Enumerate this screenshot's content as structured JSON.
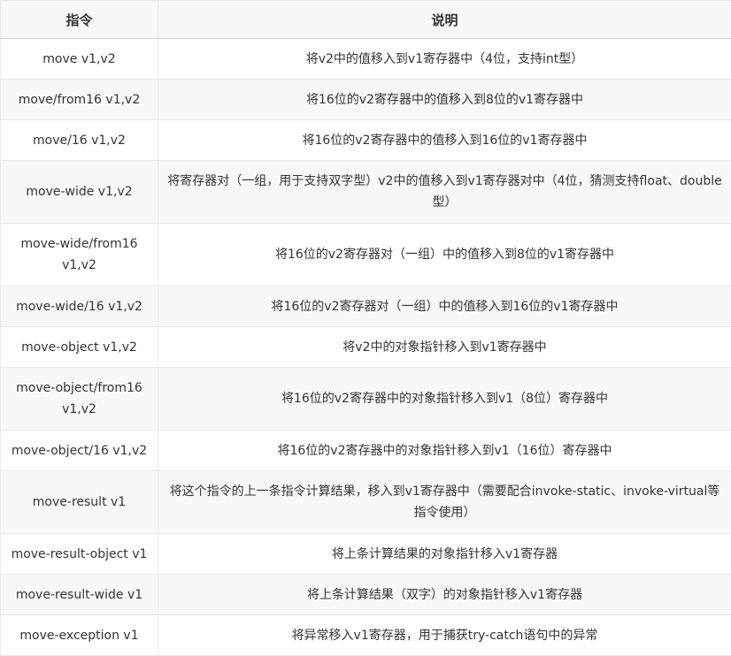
{
  "table": {
    "headers": [
      "指令",
      "说明"
    ],
    "rows": [
      {
        "instr": "move v1,v2",
        "desc": "将v2中的值移入到v1寄存器中（4位，支持int型）"
      },
      {
        "instr": "move/from16 v1,v2",
        "desc": "将16位的v2寄存器中的值移入到8位的v1寄存器中"
      },
      {
        "instr": "move/16 v1,v2",
        "desc": "将16位的v2寄存器中的值移入到16位的v1寄存器中"
      },
      {
        "instr": "move-wide v1,v2",
        "desc": "将寄存器对（一组，用于支持双字型）v2中的值移入到v1寄存器对中（4位，猜测支持float、double型）"
      },
      {
        "instr": "move-wide/from16 v1,v2",
        "desc": "将16位的v2寄存器对（一组）中的值移入到8位的v1寄存器中"
      },
      {
        "instr": "move-wide/16 v1,v2",
        "desc": "将16位的v2寄存器对（一组）中的值移入到16位的v1寄存器中"
      },
      {
        "instr": "move-object v1,v2",
        "desc": "将v2中的对象指针移入到v1寄存器中"
      },
      {
        "instr": "move-object/from16 v1,v2",
        "desc": "将16位的v2寄存器中的对象指针移入到v1（8位）寄存器中"
      },
      {
        "instr": "move-object/16 v1,v2",
        "desc": "将16位的v2寄存器中的对象指针移入到v1（16位）寄存器中"
      },
      {
        "instr": "move-result v1",
        "desc": "将这个指令的上一条指令计算结果，移入到v1寄存器中（需要配合invoke-static、invoke-virtual等指令使用）"
      },
      {
        "instr": "move-result-object v1",
        "desc": "将上条计算结果的对象指针移入v1寄存器"
      },
      {
        "instr": "move-result-wide v1",
        "desc": "将上条计算结果（双字）的对象指针移入v1寄存器"
      },
      {
        "instr": "move-exception v1",
        "desc": "将异常移入v1寄存器，用于捕获try-catch语句中的异常"
      }
    ]
  }
}
